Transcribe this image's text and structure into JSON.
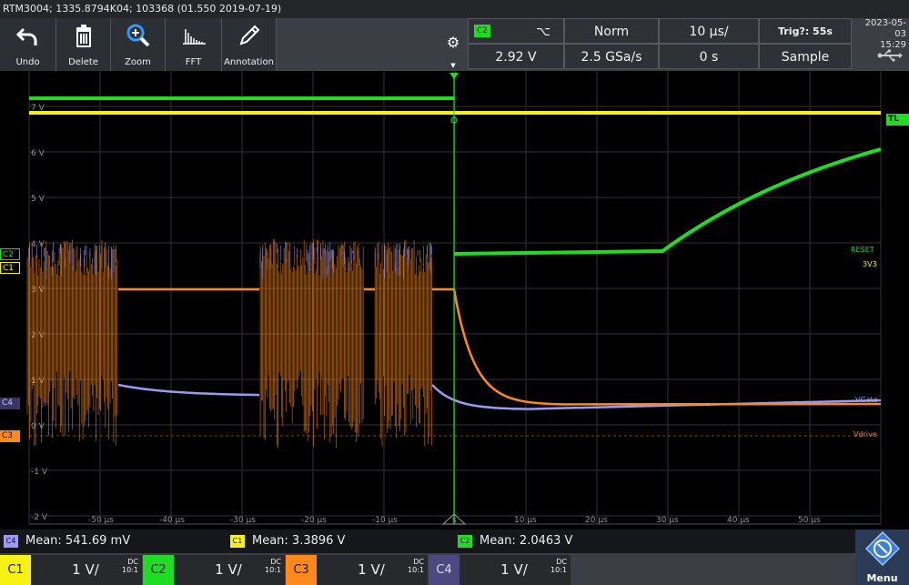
{
  "title": "RTM3004; 1335.8794K04; 103368 (01.550 2019-07-19)",
  "toolbar": {
    "buttons": [
      {
        "label": "Undo",
        "icon": "undo-icon"
      },
      {
        "label": "Delete",
        "icon": "trash-icon"
      },
      {
        "label": "Zoom",
        "icon": "zoom-icon"
      },
      {
        "label": "FFT",
        "icon": "fft-icon"
      },
      {
        "label": "Annotation",
        "icon": "pen-icon"
      }
    ],
    "settings_icon": "gear-icon"
  },
  "trigger": {
    "source": "C2",
    "slope_symbol": "⌥",
    "level": "2.92 V",
    "mode": "Norm",
    "sample_rate": "2.5 GSa/s",
    "timebase": "10 µs/",
    "position": "0 s",
    "trig_status": "Trig?: 55s",
    "acquisition": "Sample"
  },
  "datetime": {
    "date": "2023-05-03",
    "time": "15:29"
  },
  "usb_icon": "usb-icon",
  "colors": {
    "c1": "#f7f214",
    "c2": "#1fdc25",
    "c3": "#ff8a1a",
    "c4": "#9f98f5",
    "grid": "#2e3238"
  },
  "plot": {
    "y_labels": [
      "7 V",
      "6 V",
      "5 V",
      "4 V",
      "3 V",
      "2 V",
      "1 V",
      "0 V",
      "-1 V",
      "-2 V"
    ],
    "x_labels": [
      "-50 µs",
      "-40 µs",
      "-30 µs",
      "-20 µs",
      "-10 µs",
      "s",
      "10 µs",
      "20 µs",
      "30 µs",
      "40 µs",
      "50 µs"
    ],
    "trace_labels": {
      "reset": "RESET",
      "v3v3": "3V3",
      "vgate": "VGate",
      "vdrive": "Vdrive"
    },
    "channel_markers": [
      "C2",
      "C1",
      "C4",
      "C3"
    ],
    "trigger_level_marker": "TL"
  },
  "measurements": [
    {
      "channel": "C4",
      "text": "Mean: 541.69 mV"
    },
    {
      "channel": "C1",
      "text": "Mean: 3.3896 V"
    },
    {
      "channel": "C2",
      "text": "Mean: 2.0463 V"
    }
  ],
  "channels": [
    {
      "name": "C1",
      "scale": "1 V/",
      "coupling": "DC",
      "probe": "10:1"
    },
    {
      "name": "C2",
      "scale": "1 V/",
      "coupling": "DC",
      "probe": "10:1"
    },
    {
      "name": "C3",
      "scale": "1 V/",
      "coupling": "DC",
      "probe": "10:1"
    },
    {
      "name": "C4",
      "scale": "1 V/",
      "coupling": "DC",
      "probe": "10:1"
    }
  ],
  "menu_label": "Menu"
}
